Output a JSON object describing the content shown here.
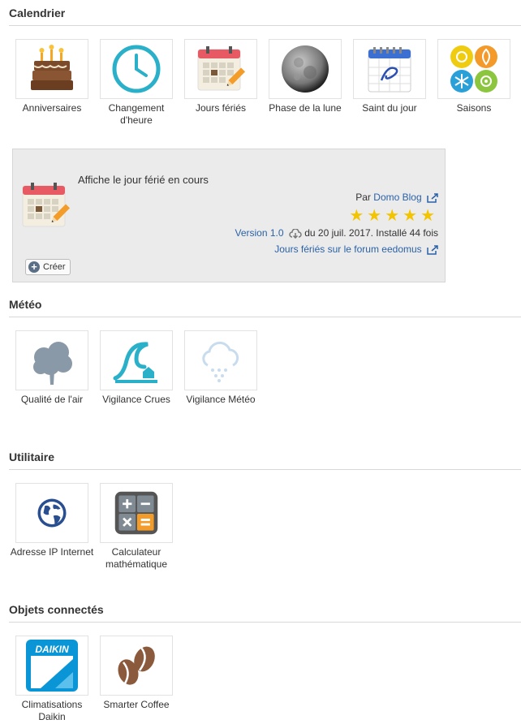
{
  "sections": {
    "calendrier": {
      "title": "Calendrier",
      "tiles": [
        {
          "label": "Anniversaires",
          "icon": "birthday-cake-icon"
        },
        {
          "label": "Changement d'heure",
          "icon": "clock-icon"
        },
        {
          "label": "Jours fériés",
          "icon": "calendar-pencil-icon"
        },
        {
          "label": "Phase de la lune",
          "icon": "moon-icon"
        },
        {
          "label": "Saint du jour",
          "icon": "calendar-icon"
        },
        {
          "label": "Saisons",
          "icon": "seasons-icon"
        }
      ]
    },
    "meteo": {
      "title": "Météo",
      "tiles": [
        {
          "label": "Qualité de l'air",
          "icon": "tree-icon"
        },
        {
          "label": "Vigilance Crues",
          "icon": "flood-wave-icon"
        },
        {
          "label": "Vigilance Météo",
          "icon": "snow-cloud-icon"
        }
      ]
    },
    "utilitaire": {
      "title": "Utilitaire",
      "tiles": [
        {
          "label": "Adresse IP Internet",
          "icon": "globe-icon"
        },
        {
          "label": "Calculateur mathématique",
          "icon": "calculator-icon"
        }
      ]
    },
    "objets": {
      "title": "Objets connectés",
      "tiles": [
        {
          "label": "Climatisations Daikin",
          "icon": "daikin-logo-icon",
          "logo_text": "DAIKIN"
        },
        {
          "label": "Smarter Coffee",
          "icon": "coffee-beans-icon"
        }
      ]
    }
  },
  "detail": {
    "description": "Affiche le jour férié en cours",
    "by_prefix": "Par",
    "author": "Domo Blog",
    "rating": 5,
    "version": "Version 1.0",
    "date_text": "du 20 juil. 2017. Installé 44 fois",
    "forum_link": "Jours fériés sur le forum eedomus",
    "create_label": "Créer"
  },
  "colors": {
    "link": "#2a62a8",
    "star": "#f3c400",
    "panel_bg": "#ebebeb",
    "clock": "#2bb0c9",
    "daikin": "#0a96d6",
    "calc_orange": "#f39c2a",
    "globe": "#2a62a8"
  }
}
